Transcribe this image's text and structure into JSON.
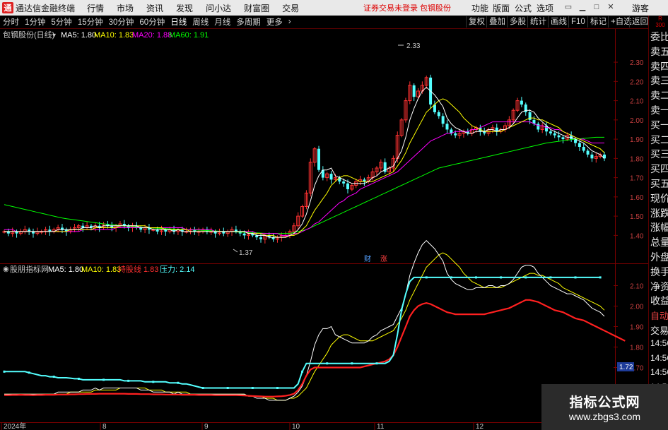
{
  "titlebar": {
    "logo_glyph": "通",
    "app_name": "通达信金融终端",
    "menus": [
      "行情",
      "市场",
      "资讯",
      "发现",
      "问小达",
      "财富圈",
      "交易"
    ],
    "notice": "证券交易未登录  包钢股份",
    "right_menus": [
      "功能",
      "版面",
      "公式",
      "选项"
    ],
    "guest": "游客"
  },
  "toolbar": {
    "periods": [
      "分时",
      "1分钟",
      "5分钟",
      "15分钟",
      "30分钟",
      "60分钟",
      "日线",
      "周线",
      "月线",
      "多周期",
      "更多"
    ],
    "active": "日线",
    "right_buttons": [
      "复权",
      "叠加",
      "多股",
      "统计",
      "画线",
      "F10",
      "标记",
      "+自选",
      "返回"
    ]
  },
  "main_chart": {
    "stock_label": "包钢股份(日线)",
    "ma5_label": "MA5: 1.80",
    "ma10_label": "MA10: 1.83",
    "ma20_label": "MA20: 1.88",
    "ma60_label": "MA60: 1.91",
    "high_label": "2.33",
    "low_label": "1.37",
    "marker_cai": "财",
    "marker_zhang": "涨",
    "y_ticks": [
      "2.30",
      "2.20",
      "2.10",
      "2.00",
      "1.90",
      "1.80",
      "1.70",
      "1.60",
      "1.50",
      "1.40"
    ]
  },
  "indicator": {
    "name": "股朋指标网",
    "ma5_label": "MA5: 1.80",
    "ma10_label": "MA10: 1.83",
    "hold_label": "持股线",
    "hold_value": "1.83",
    "pressure_label": "压力: 2.14",
    "y_ticks": [
      "2.10",
      "2.00",
      "1.90",
      "1.80",
      "1.70",
      "1.60"
    ],
    "current_value": "1.72"
  },
  "x_axis": {
    "labels": [
      "2024年",
      "8",
      "9",
      "10",
      "11",
      "12"
    ]
  },
  "right_sidebar": {
    "top_label_1": "R",
    "top_label_2": "300",
    "items": [
      "委比",
      "卖五",
      "卖四",
      "卖三",
      "卖二",
      "卖一",
      "买一",
      "买二",
      "买三",
      "买四",
      "买五",
      "现价",
      "涨跌",
      "涨幅",
      "总量",
      "外盘",
      "换手",
      "净资",
      "收益",
      "自动",
      "交易",
      "14:56",
      "14:56",
      "14:56",
      "14:56",
      "14:56",
      "14:56",
      "14:56",
      "14:56"
    ]
  },
  "watermark": {
    "line1": "指标公式网",
    "line2": "www.zbgs3.com"
  },
  "colors": {
    "ma5": "#ffffff",
    "ma10": "#ffff00",
    "ma20": "#ff00ff",
    "ma60": "#00ff00",
    "up": "#ff3232",
    "down": "#54ffff",
    "pressure": "#54ffff",
    "hold": "#ff2020"
  },
  "chart_data": [
    {
      "type": "candlestick",
      "title": "包钢股份(日线)",
      "ylim": [
        1.35,
        2.37
      ],
      "annotations": {
        "high": 2.33,
        "low": 1.37
      },
      "series": [
        {
          "name": "MA5",
          "last": 1.8
        },
        {
          "name": "MA10",
          "last": 1.83
        },
        {
          "name": "MA20",
          "last": 1.88
        },
        {
          "name": "MA60",
          "last": 1.91
        }
      ],
      "x_labels": [
        "2024年",
        "8",
        "9",
        "10",
        "11",
        "12"
      ],
      "close": [
        1.42,
        1.41,
        1.42,
        1.41,
        1.42,
        1.43,
        1.42,
        1.41,
        1.42,
        1.42,
        1.43,
        1.42,
        1.43,
        1.44,
        1.43,
        1.42,
        1.43,
        1.44,
        1.45,
        1.44,
        1.45,
        1.44,
        1.45,
        1.44,
        1.46,
        1.45,
        1.44,
        1.45,
        1.46,
        1.45,
        1.44,
        1.45,
        1.44,
        1.43,
        1.44,
        1.43,
        1.43,
        1.42,
        1.43,
        1.42,
        1.43,
        1.42,
        1.43,
        1.42,
        1.42,
        1.43,
        1.42,
        1.42,
        1.43,
        1.42,
        1.42,
        1.41,
        1.42,
        1.41,
        1.42,
        1.43,
        1.42,
        1.41,
        1.4,
        1.41,
        1.4,
        1.39,
        1.38,
        1.4,
        1.39,
        1.38,
        1.39,
        1.4,
        1.4,
        1.42,
        1.45,
        1.5,
        1.55,
        1.62,
        1.78,
        1.85,
        1.74,
        1.7,
        1.72,
        1.69,
        1.7,
        1.68,
        1.67,
        1.64,
        1.66,
        1.68,
        1.69,
        1.68,
        1.7,
        1.73,
        1.75,
        1.78,
        1.73,
        1.75,
        1.8,
        1.92,
        2.0,
        2.1,
        2.18,
        2.12,
        2.15,
        2.18,
        2.22,
        2.08,
        2.04,
        2.02,
        1.98,
        1.95,
        1.93,
        1.92,
        1.93,
        1.94,
        1.93,
        1.95,
        1.96,
        1.94,
        1.93,
        1.95,
        1.96,
        1.94,
        1.95,
        1.97,
        2.0,
        2.05,
        2.1,
        2.08,
        2.04,
        2.0,
        1.98,
        1.95,
        1.97,
        1.94,
        1.93,
        1.92,
        1.91,
        1.9,
        1.92,
        1.9,
        1.88,
        1.86,
        1.84,
        1.82,
        1.8,
        1.81,
        1.82,
        1.8
      ],
      "ma5": [
        1.42,
        1.42,
        1.42,
        1.42,
        1.42,
        1.42,
        1.42,
        1.42,
        1.42,
        1.42,
        1.42,
        1.42,
        1.42,
        1.43,
        1.43,
        1.43,
        1.43,
        1.43,
        1.43,
        1.44,
        1.44,
        1.44,
        1.45,
        1.44,
        1.45,
        1.45,
        1.45,
        1.45,
        1.45,
        1.45,
        1.45,
        1.45,
        1.45,
        1.44,
        1.44,
        1.44,
        1.43,
        1.43,
        1.43,
        1.43,
        1.43,
        1.42,
        1.43,
        1.42,
        1.42,
        1.42,
        1.42,
        1.42,
        1.42,
        1.42,
        1.42,
        1.42,
        1.42,
        1.42,
        1.42,
        1.42,
        1.42,
        1.42,
        1.42,
        1.41,
        1.41,
        1.4,
        1.4,
        1.4,
        1.39,
        1.39,
        1.39,
        1.39,
        1.39,
        1.4,
        1.41,
        1.43,
        1.46,
        1.51,
        1.58,
        1.66,
        1.71,
        1.74,
        1.74,
        1.75,
        1.71,
        1.7,
        1.69,
        1.68,
        1.67,
        1.67,
        1.67,
        1.67,
        1.68,
        1.7,
        1.71,
        1.73,
        1.74,
        1.75,
        1.76,
        1.8,
        1.84,
        1.91,
        2.0,
        2.06,
        2.11,
        2.15,
        2.17,
        2.15,
        2.13,
        2.1,
        2.07,
        2.01,
        1.98,
        1.96,
        1.95,
        1.94,
        1.93,
        1.93,
        1.94,
        1.94,
        1.94,
        1.95,
        1.95,
        1.94,
        1.95,
        1.95,
        1.96,
        1.98,
        2.01,
        2.04,
        2.05,
        2.05,
        2.04,
        2.01,
        1.99,
        1.97,
        1.95,
        1.94,
        1.93,
        1.92,
        1.91,
        1.91,
        1.9,
        1.89,
        1.88,
        1.86,
        1.84,
        1.83,
        1.82,
        1.8
      ],
      "ma10": [
        1.42,
        1.42,
        1.42,
        1.42,
        1.42,
        1.42,
        1.42,
        1.42,
        1.42,
        1.42,
        1.42,
        1.42,
        1.42,
        1.42,
        1.42,
        1.42,
        1.43,
        1.43,
        1.43,
        1.43,
        1.43,
        1.43,
        1.44,
        1.44,
        1.44,
        1.44,
        1.44,
        1.44,
        1.45,
        1.45,
        1.45,
        1.45,
        1.45,
        1.45,
        1.45,
        1.44,
        1.44,
        1.44,
        1.44,
        1.43,
        1.43,
        1.43,
        1.43,
        1.43,
        1.43,
        1.42,
        1.42,
        1.42,
        1.42,
        1.42,
        1.42,
        1.42,
        1.42,
        1.42,
        1.42,
        1.42,
        1.42,
        1.42,
        1.42,
        1.41,
        1.41,
        1.41,
        1.41,
        1.4,
        1.4,
        1.4,
        1.39,
        1.39,
        1.39,
        1.4,
        1.4,
        1.41,
        1.43,
        1.45,
        1.49,
        1.53,
        1.56,
        1.59,
        1.62,
        1.66,
        1.68,
        1.7,
        1.71,
        1.71,
        1.7,
        1.69,
        1.68,
        1.68,
        1.68,
        1.68,
        1.69,
        1.7,
        1.71,
        1.72,
        1.73,
        1.76,
        1.79,
        1.83,
        1.88,
        1.92,
        1.96,
        2.0,
        2.04,
        2.06,
        2.08,
        2.1,
        2.11,
        2.1,
        2.08,
        2.06,
        2.04,
        2.01,
        1.99,
        1.97,
        1.96,
        1.95,
        1.94,
        1.94,
        1.94,
        1.94,
        1.94,
        1.95,
        1.96,
        1.97,
        1.98,
        1.99,
        2.0,
        2.01,
        2.01,
        2.0,
        2.0,
        1.99,
        1.98,
        1.97,
        1.96,
        1.94,
        1.93,
        1.92,
        1.91,
        1.9,
        1.89,
        1.88,
        1.87,
        1.86,
        1.85,
        1.83
      ],
      "ma20": [
        1.43,
        1.43,
        1.43,
        1.42,
        1.42,
        1.42,
        1.42,
        1.42,
        1.42,
        1.42,
        1.42,
        1.42,
        1.42,
        1.42,
        1.42,
        1.42,
        1.42,
        1.42,
        1.42,
        1.43,
        1.43,
        1.43,
        1.43,
        1.43,
        1.43,
        1.43,
        1.43,
        1.44,
        1.44,
        1.44,
        1.44,
        1.44,
        1.44,
        1.44,
        1.44,
        1.44,
        1.44,
        1.44,
        1.44,
        1.44,
        1.44,
        1.44,
        1.44,
        1.44,
        1.43,
        1.43,
        1.43,
        1.43,
        1.43,
        1.43,
        1.43,
        1.42,
        1.42,
        1.42,
        1.42,
        1.42,
        1.42,
        1.42,
        1.42,
        1.42,
        1.42,
        1.41,
        1.41,
        1.41,
        1.41,
        1.41,
        1.41,
        1.4,
        1.4,
        1.4,
        1.41,
        1.41,
        1.42,
        1.43,
        1.44,
        1.46,
        1.47,
        1.49,
        1.51,
        1.53,
        1.55,
        1.57,
        1.58,
        1.6,
        1.61,
        1.62,
        1.64,
        1.65,
        1.66,
        1.67,
        1.68,
        1.69,
        1.7,
        1.71,
        1.72,
        1.73,
        1.75,
        1.77,
        1.79,
        1.81,
        1.83,
        1.85,
        1.87,
        1.89,
        1.9,
        1.91,
        1.92,
        1.93,
        1.93,
        1.94,
        1.94,
        1.94,
        1.94,
        1.95,
        1.95,
        1.96,
        1.97,
        1.98,
        1.99,
        1.99,
        1.99,
        1.99,
        1.99,
        1.99,
        1.99,
        1.99,
        1.99,
        1.99,
        1.98,
        1.97,
        1.97,
        1.96,
        1.96,
        1.95,
        1.95,
        1.94,
        1.93,
        1.92,
        1.91,
        1.9,
        1.9,
        1.89,
        1.88,
        1.88,
        1.88,
        1.88
      ],
      "ma60": [
        1.56,
        1.555,
        1.55,
        1.545,
        1.54,
        1.535,
        1.53,
        1.525,
        1.52,
        1.515,
        1.51,
        1.505,
        1.5,
        1.495,
        1.49,
        1.487,
        1.484,
        1.481,
        1.478,
        1.475,
        1.472,
        1.469,
        1.466,
        1.463,
        1.46,
        1.458,
        1.456,
        1.454,
        1.452,
        1.45,
        1.448,
        1.446,
        1.444,
        1.442,
        1.44,
        1.439,
        1.438,
        1.437,
        1.436,
        1.435,
        1.434,
        1.433,
        1.432,
        1.431,
        1.43,
        1.429,
        1.428,
        1.427,
        1.426,
        1.425,
        1.424,
        1.423,
        1.422,
        1.421,
        1.42,
        1.419,
        1.418,
        1.417,
        1.416,
        1.415,
        1.414,
        1.413,
        1.412,
        1.411,
        1.41,
        1.41,
        1.41,
        1.41,
        1.41,
        1.41,
        1.415,
        1.42,
        1.425,
        1.43,
        1.44,
        1.45,
        1.46,
        1.47,
        1.48,
        1.49,
        1.5,
        1.51,
        1.52,
        1.53,
        1.54,
        1.55,
        1.56,
        1.57,
        1.58,
        1.59,
        1.6,
        1.61,
        1.62,
        1.63,
        1.64,
        1.65,
        1.66,
        1.67,
        1.68,
        1.69,
        1.7,
        1.71,
        1.72,
        1.73,
        1.74,
        1.75,
        1.755,
        1.76,
        1.765,
        1.77,
        1.775,
        1.78,
        1.785,
        1.79,
        1.795,
        1.8,
        1.805,
        1.81,
        1.815,
        1.82,
        1.825,
        1.83,
        1.835,
        1.84,
        1.845,
        1.85,
        1.855,
        1.86,
        1.865,
        1.87,
        1.875,
        1.88,
        1.883,
        1.886,
        1.889,
        1.892,
        1.895,
        1.898,
        1.9,
        1.902,
        1.904,
        1.906,
        1.908,
        1.91,
        1.91,
        1.91
      ]
    },
    {
      "type": "line",
      "title": "股朋指标网",
      "ylim": [
        1.55,
        2.15
      ],
      "series": [
        {
          "name": "MA5",
          "last": 1.8
        },
        {
          "name": "MA10",
          "last": 1.83
        },
        {
          "name": "持股线",
          "last": 1.83
        },
        {
          "name": "压力",
          "last": 2.14
        }
      ],
      "pressure": [
        1.68,
        1.68,
        1.68,
        1.68,
        1.68,
        1.68,
        1.675,
        1.67,
        1.665,
        1.66,
        1.66,
        1.655,
        1.655,
        1.65,
        1.65,
        1.65,
        1.648,
        1.645,
        1.645,
        1.64,
        1.64,
        1.64,
        1.64,
        1.64,
        1.64,
        1.64,
        1.64,
        1.64,
        1.64,
        1.635,
        1.635,
        1.635,
        1.635,
        1.635,
        1.63,
        1.63,
        1.63,
        1.63,
        1.63,
        1.63,
        1.625,
        1.625,
        1.625,
        1.62,
        1.62,
        1.615,
        1.61,
        1.605,
        1.6,
        1.6,
        1.6,
        1.6,
        1.6,
        1.6,
        1.6,
        1.6,
        1.6,
        1.6,
        1.6,
        1.6,
        1.6,
        1.6,
        1.6,
        1.6,
        1.6,
        1.6,
        1.6,
        1.6,
        1.6,
        1.6,
        1.6,
        1.62,
        1.68,
        1.72,
        1.72,
        1.72,
        1.72,
        1.72,
        1.72,
        1.72,
        1.72,
        1.72,
        1.72,
        1.72,
        1.72,
        1.72,
        1.72,
        1.72,
        1.72,
        1.72,
        1.72,
        1.72,
        1.72,
        1.73,
        1.76,
        1.86,
        1.98,
        2.06,
        2.12,
        2.14,
        2.14,
        2.14,
        2.14,
        2.14,
        2.14,
        2.14,
        2.14,
        2.14,
        2.14,
        2.14,
        2.14,
        2.14,
        2.14,
        2.14,
        2.14,
        2.14,
        2.14,
        2.14,
        2.14,
        2.14,
        2.14,
        2.14,
        2.14,
        2.14,
        2.14,
        2.14,
        2.14,
        2.14,
        2.14,
        2.14,
        2.14,
        2.14,
        2.14,
        2.14,
        2.14,
        2.14,
        2.14,
        2.14,
        2.14,
        2.14,
        2.14,
        2.14,
        2.14,
        2.14,
        2.14
      ],
      "hold": [
        1.565,
        1.565,
        1.566,
        1.566,
        1.567,
        1.566,
        1.566,
        1.565,
        1.566,
        1.566,
        1.567,
        1.567,
        1.567,
        1.568,
        1.568,
        1.568,
        1.569,
        1.569,
        1.57,
        1.57,
        1.571,
        1.571,
        1.571,
        1.572,
        1.572,
        1.572,
        1.572,
        1.572,
        1.572,
        1.572,
        1.571,
        1.571,
        1.571,
        1.57,
        1.57,
        1.57,
        1.569,
        1.569,
        1.569,
        1.568,
        1.568,
        1.568,
        1.568,
        1.567,
        1.567,
        1.567,
        1.567,
        1.566,
        1.566,
        1.566,
        1.566,
        1.565,
        1.565,
        1.565,
        1.565,
        1.565,
        1.565,
        1.564,
        1.563,
        1.562,
        1.561,
        1.56,
        1.559,
        1.558,
        1.558,
        1.558,
        1.559,
        1.56,
        1.562,
        1.566,
        1.572,
        1.59,
        1.62,
        1.66,
        1.69,
        1.7,
        1.7,
        1.7,
        1.7,
        1.7,
        1.7,
        1.7,
        1.7,
        1.7,
        1.7,
        1.7,
        1.7,
        1.705,
        1.71,
        1.715,
        1.72,
        1.725,
        1.73,
        1.74,
        1.76,
        1.8,
        1.85,
        1.9,
        1.95,
        1.98,
        2.0,
        2.01,
        2.015,
        2.01,
        2.0,
        1.99,
        1.98,
        1.97,
        1.965,
        1.96,
        1.96,
        1.96,
        1.96,
        1.96,
        1.96,
        1.96,
        1.96,
        1.965,
        1.97,
        1.975,
        1.98,
        1.985,
        1.99,
        2.0,
        2.01,
        2.02,
        2.03,
        2.03,
        2.025,
        2.02,
        2.01,
        2.0,
        1.99,
        1.98,
        1.975,
        1.97,
        1.96,
        1.95,
        1.94,
        1.935,
        1.93,
        1.92,
        1.91,
        1.9,
        1.89,
        1.88,
        1.87,
        1.86,
        1.85,
        1.84,
        1.83
      ]
    }
  ]
}
